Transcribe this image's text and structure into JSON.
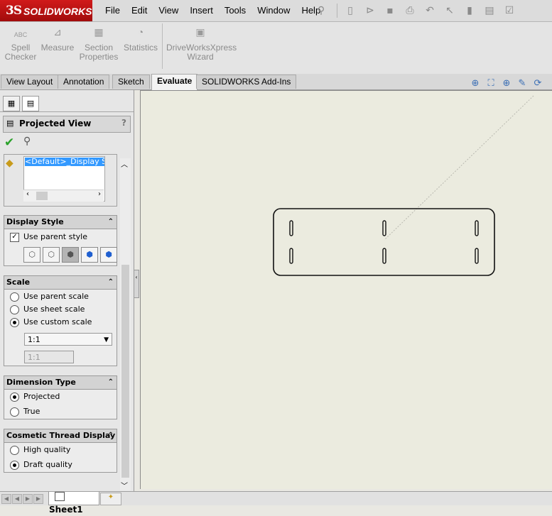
{
  "app": {
    "brand_mark": "3S",
    "brand_name": "SOLIDWORKS"
  },
  "menu": [
    "File",
    "Edit",
    "View",
    "Insert",
    "Tools",
    "Window",
    "Help"
  ],
  "quick_access_icons": [
    "pushpin-icon",
    "new-document-icon",
    "open-icon",
    "save-icon",
    "print-icon",
    "undo-icon",
    "select-icon",
    "rebuild-icon",
    "file-properties-icon",
    "options-icon"
  ],
  "commands": [
    {
      "label": "Spell\nChecker",
      "icon": "ABC",
      "name": "spell-checker"
    },
    {
      "label": "Measure",
      "icon": "⊿",
      "name": "measure"
    },
    {
      "label": "Section\nProperties",
      "icon": "▦",
      "name": "section-properties"
    },
    {
      "label": "Statistics",
      "icon": "◔",
      "name": "statistics"
    },
    {
      "label": "DriveWorksXpress\nWizard",
      "icon": "▣",
      "name": "driveworksxpress-wizard"
    }
  ],
  "tabs": [
    {
      "label": "View Layout",
      "active": false
    },
    {
      "label": "Annotation",
      "active": false
    },
    {
      "label": "Sketch",
      "active": false
    },
    {
      "label": "Evaluate",
      "active": true
    },
    {
      "label": "SOLIDWORKS Add-Ins",
      "active": false
    }
  ],
  "property_manager": {
    "title": "Projected View",
    "help": "?",
    "style_list": {
      "selected": "<Default>_Display St"
    },
    "display_style": {
      "header": "Display Style",
      "use_parent_style": {
        "label": "Use parent style",
        "checked": true
      },
      "buttons": [
        "wireframe",
        "hidden-lines-visible",
        "hidden-lines-removed",
        "shaded-with-edges",
        "shaded"
      ],
      "selected_button": "hidden-lines-removed"
    },
    "scale": {
      "header": "Scale",
      "options": [
        {
          "label": "Use parent scale",
          "selected": false
        },
        {
          "label": "Use sheet scale",
          "selected": false
        },
        {
          "label": "Use custom scale",
          "selected": true
        }
      ],
      "dropdown_value": "1:1",
      "custom_value": "1:1"
    },
    "dimension_type": {
      "header": "Dimension Type",
      "options": [
        {
          "label": "Projected",
          "selected": true
        },
        {
          "label": "True",
          "selected": false
        }
      ]
    },
    "cosmetic_thread": {
      "header": "Cosmetic Thread Display",
      "options": [
        {
          "label": "High quality",
          "selected": false
        },
        {
          "label": "Draft quality",
          "selected": true
        }
      ]
    }
  },
  "heads_up_icons": [
    "zoom-to-fit-icon",
    "zoom-to-area-icon",
    "zoom-in-out-icon",
    "section-view-icon",
    "rotate-icon"
  ],
  "sheet": {
    "name": "Sheet1"
  }
}
